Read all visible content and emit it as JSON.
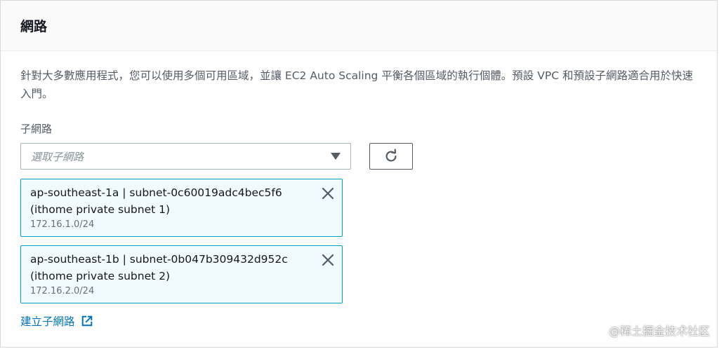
{
  "panel": {
    "title": "網路",
    "description": "針對大多數應用程式，您可以使用多個可用區域，並讓 EC2 Auto Scaling 平衡各個區域的執行個體。預設 VPC 和預設子網路適合用於快速入門。"
  },
  "subnet_field": {
    "label": "子網路",
    "placeholder": "選取子網路"
  },
  "selected_subnets": [
    {
      "line1": "ap-southeast-1a | subnet-0c60019adc4bec5f6",
      "line2": "(ithome private subnet 1)",
      "cidr": "172.16.1.0/24"
    },
    {
      "line1": "ap-southeast-1b | subnet-0b047b309432d952c",
      "line2": "(ithome private subnet 2)",
      "cidr": "172.16.2.0/24"
    }
  ],
  "create_link": {
    "label": "建立子網路"
  },
  "icons": {
    "refresh": "refresh-icon",
    "dismiss": "close-icon",
    "external": "external-link-icon",
    "caret": "caret-down-icon"
  },
  "colors": {
    "link": "#0073bb",
    "token_border": "#00a1c9",
    "token_background": "#f1faff"
  },
  "watermark": "@稀土掘金技术社区"
}
